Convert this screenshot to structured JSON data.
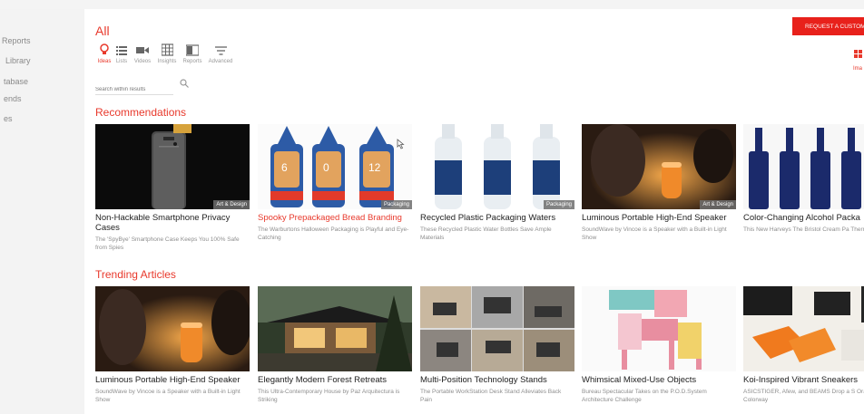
{
  "sidebar": {
    "items": [
      {
        "label": "Reports"
      },
      {
        "label": "Library"
      },
      {
        "label": "tabase"
      },
      {
        "label": "ends"
      },
      {
        "label": "es"
      }
    ]
  },
  "header": {
    "title": "All",
    "request_button": "Request a custom",
    "grid_label": "Ima"
  },
  "filters": [
    {
      "label": "Ideas",
      "icon": "lightbulb-icon",
      "active": true
    },
    {
      "label": "Lists",
      "icon": "list-icon",
      "active": false
    },
    {
      "label": "Videos",
      "icon": "video-icon",
      "active": false
    },
    {
      "label": "Insights",
      "icon": "insights-icon",
      "active": false
    },
    {
      "label": "Reports",
      "icon": "reports-icon",
      "active": false
    },
    {
      "label": "Advanced",
      "icon": "advanced-filter-icon",
      "active": false
    }
  ],
  "search": {
    "placeholder": "Search within results"
  },
  "recommendations": {
    "title": "Recommendations",
    "cards": [
      {
        "title": "Non-Hackable Smartphone Privacy Cases",
        "desc": "The 'SpyBye' Smartphone Case Keeps You 100% Safe from Spies",
        "tag": "Art & Design"
      },
      {
        "title": "Spooky Prepackaged Bread Branding",
        "desc": "The Warburtons Halloween Packaging is Playful and Eye-Catching",
        "tag": "Packaging"
      },
      {
        "title": "Recycled Plastic Packaging Waters",
        "desc": "These Recycled Plastic Water Bottles Save Ample Materials",
        "tag": "Packaging"
      },
      {
        "title": "Luminous Portable High-End Speaker",
        "desc": "SoundWave by Vincoe is a Speaker with a Built-in Light Show",
        "tag": "Art & Design"
      },
      {
        "title": "Color-Changing Alcohol Packa",
        "desc": "This New Harveys The Bristol Cream Pa Thermochromic",
        "tag": ""
      }
    ]
  },
  "trending": {
    "title": "Trending Articles",
    "cards": [
      {
        "title": "Luminous Portable High-End Speaker",
        "desc": "SoundWave by Vincoe is a Speaker with a Built-in Light Show"
      },
      {
        "title": "Elegantly Modern Forest Retreats",
        "desc": "This Ultra-Contemporary House by Paz Arquitectura is Striking"
      },
      {
        "title": "Multi-Position Technology Stands",
        "desc": "The Portable WorkStation Desk Stand Alleviates Back Pain"
      },
      {
        "title": "Whimsical Mixed-Use Objects",
        "desc": "Bureau Spectacular Takes on the P.O.D.System Architecture Challenge"
      },
      {
        "title": "Koi-Inspired Vibrant Sneakers",
        "desc": "ASICSTIGER, Afew, and BEAMS Drop a S Orange Koi Colorway"
      }
    ]
  },
  "colors": {
    "accent": "#e8392c",
    "button": "#e8211b"
  }
}
